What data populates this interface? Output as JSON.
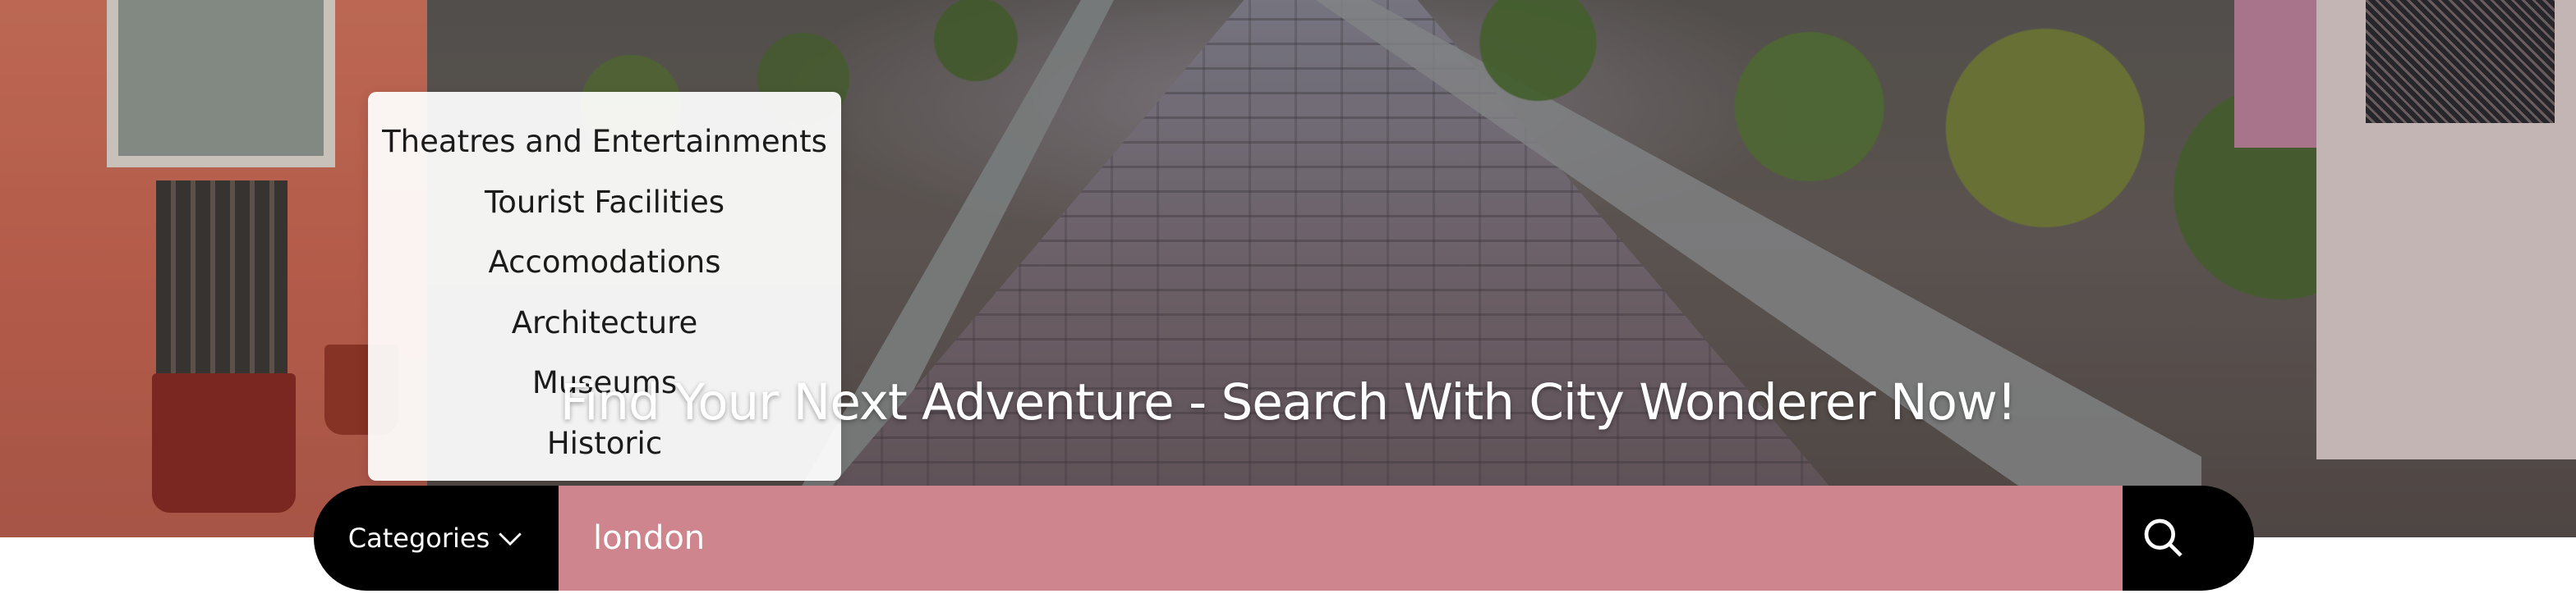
{
  "hero": {
    "title": "Find Your Next Adventure - Search With City Wonderer Now!"
  },
  "search": {
    "categories_label": "Categories",
    "query_value": "london",
    "placeholder": ""
  },
  "dropdown": {
    "items": [
      {
        "label": "Theatres and Entertainments"
      },
      {
        "label": "Tourist Facilities"
      },
      {
        "label": "Accomodations"
      },
      {
        "label": "Architecture"
      },
      {
        "label": "Museums"
      },
      {
        "label": "Historic"
      }
    ]
  },
  "icons": {
    "search": "search-icon",
    "chevron": "chevron-down-icon"
  },
  "colors": {
    "search_field": "#cf858e",
    "bar_black": "#000000",
    "title_text": "#ffffff"
  }
}
